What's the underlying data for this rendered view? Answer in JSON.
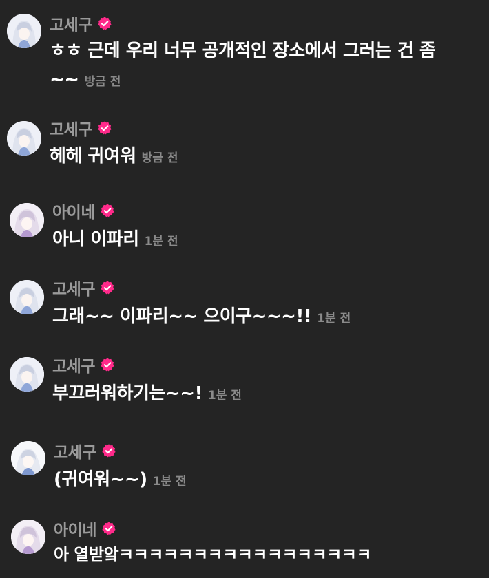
{
  "colors": {
    "background": "#242424",
    "name": "#9b9b9b",
    "text": "#ffffff",
    "time": "#8a8a8a",
    "verified_badge": "#ff2a8a"
  },
  "messages": [
    {
      "user": "고세구",
      "verified_icon": "verified-check-icon",
      "text": "ㅎㅎ 근데 우리 너무 공개적인 장소에서 그러는 건 좀~~",
      "time": "방금 전"
    },
    {
      "user": "고세구",
      "verified_icon": "verified-check-icon",
      "text": "헤헤 귀여워",
      "time": "방금 전"
    },
    {
      "user": "아이네",
      "verified_icon": "verified-check-icon",
      "text": "아니 이파리",
      "time": "1분 전"
    },
    {
      "user": "고세구",
      "verified_icon": "verified-check-icon",
      "text": "그래~~ 이파리~~ 으이구~~~!!",
      "time": "1분 전"
    },
    {
      "user": "고세구",
      "verified_icon": "verified-check-icon",
      "text": "부끄러워하기는~~!",
      "time": "1분 전"
    },
    {
      "user": "고세구",
      "verified_icon": "verified-check-icon",
      "text": "(귀여워~~)",
      "time": "1분 전"
    },
    {
      "user": "아이네",
      "verified_icon": "verified-check-icon",
      "text": "아 열받앜ㅋㅋㅋㅋㅋㅋㅋㅋㅋㅋㅋㅋㅋㅋㅋㅋㅋ",
      "time": ""
    }
  ]
}
